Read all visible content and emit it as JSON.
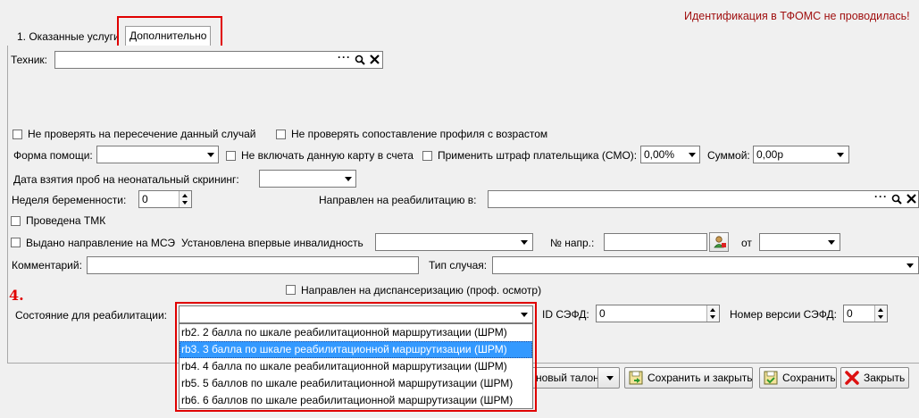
{
  "header": {
    "alert": "Идентификация в ТФОМС не проводилась!"
  },
  "tabs": [
    {
      "label": "1. Оказанные услуги"
    },
    {
      "label": "Дополнительно"
    }
  ],
  "form": {
    "technician_label": "Техник:",
    "no_check_intersection": "Не проверять на пересечение данный случай",
    "no_check_profile_age": "Не проверять сопоставление профиля с возрастом",
    "help_form_label": "Форма помощи:",
    "exclude_from_invoice": "Не включать данную карту в счета",
    "apply_penalty": "Применить штраф плательщика (СМО):",
    "penalty_percent": "0,00%",
    "sum_label": "Суммой:",
    "sum_value": "0,00р",
    "neonatal_date_label": "Дата взятия проб на неонатальный скрининг:",
    "pregnancy_week_label": "Неделя беременности:",
    "pregnancy_week_value": "0",
    "rehab_referral_label": "Направлен на реабилитацию в:",
    "tmk_label": "Проведена ТМК",
    "mse_referral_label": "Выдано направление на МСЭ",
    "disability_label": "Установлена впервые инвалидность",
    "referral_number_label": "№ напр.:",
    "from_label": "от",
    "comment_label": "Комментарий:",
    "case_type_label": "Тип случая:",
    "dispensary_label": "Направлен на диспансеризацию (проф. осмотр)",
    "rehab_state_label": "Состояние для реабилитации:",
    "sefd_id_label": "ID СЭФД:",
    "sefd_id_value": "0",
    "sefd_version_label": "Номер версии СЭФД:",
    "sefd_version_value": "0"
  },
  "annotation": {
    "step": "4."
  },
  "dropdown": {
    "options": [
      "rb2. 2 балла по шкале реабилитационной маршрутизации (ШРМ)",
      "rb3. 3 балла по шкале реабилитационной маршрутизации (ШРМ)",
      "rb4. 4 балла по шкале реабилитационной маршрутизации (ШРМ)",
      "rb5. 5 баллов по шкале реабилитационной маршрутизации (ШРМ)",
      "rb6. 6 баллов по шкале реабилитационной маршрутизации (ШРМ)"
    ],
    "selected_index": 1
  },
  "buttons": {
    "new_ticket": "новый талон",
    "save_close": "Сохранить и закрыть",
    "save": "Сохранить",
    "close": "Закрыть"
  },
  "colors": {
    "highlight": "#e00000",
    "selection": "#3399ff",
    "alert": "#a01010"
  }
}
